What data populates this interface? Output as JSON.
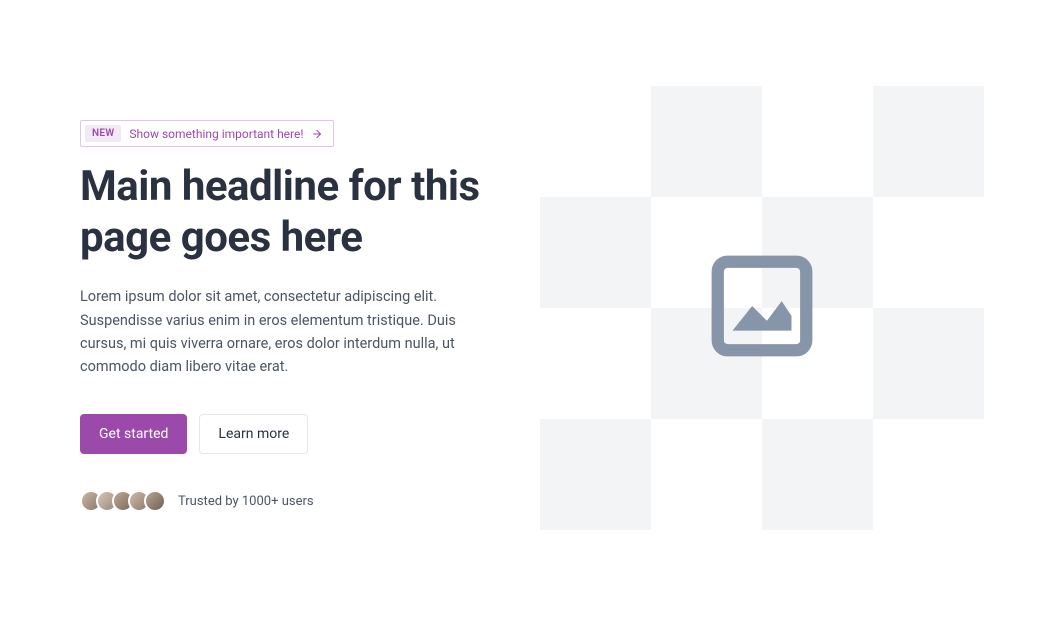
{
  "badge": {
    "tag": "NEW",
    "text": "Show something important here!"
  },
  "headline": "Main headline for this page goes here",
  "body": "Lorem ipsum dolor sit amet, consectetur adipiscing elit. Suspendisse varius enim in eros elementum tristique. Duis cursus, mi quis viverra ornare, eros dolor interdum nulla, ut commodo diam libero vitae erat.",
  "buttons": {
    "primary": "Get started",
    "secondary": "Learn more"
  },
  "social_proof": "Trusted by 1000+ users",
  "colors": {
    "accent": "#9b4aab",
    "heading": "#2a3140",
    "body_text": "#4b5563"
  }
}
